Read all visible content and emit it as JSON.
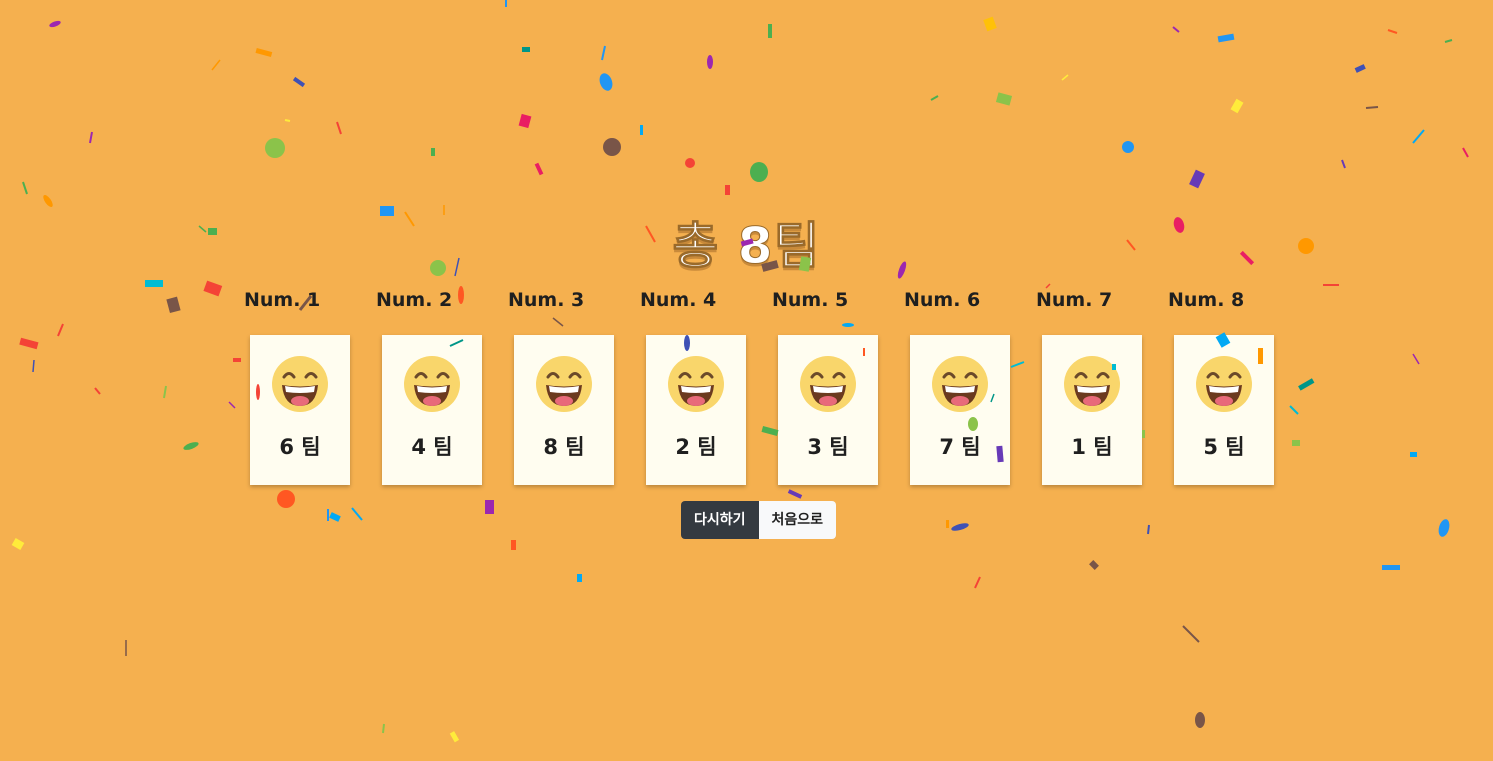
{
  "title": "총 8팀",
  "cards": [
    {
      "label": "Num. 1",
      "team": "6 팀"
    },
    {
      "label": "Num. 2",
      "team": "4 팀"
    },
    {
      "label": "Num. 3",
      "team": "8 팀"
    },
    {
      "label": "Num. 4",
      "team": "2 팀"
    },
    {
      "label": "Num. 5",
      "team": "3 팀"
    },
    {
      "label": "Num. 6",
      "team": "7 팀"
    },
    {
      "label": "Num. 7",
      "team": "1 팀"
    },
    {
      "label": "Num. 8",
      "team": "5 팀"
    }
  ],
  "buttons": {
    "retry": "다시하기",
    "home": "처음으로"
  },
  "card_icon": "grinning-face-icon",
  "colors": {
    "background": "#F5B04F",
    "card": "#FFFDF0",
    "retry_button": "#343a40",
    "home_button": "#f8f9fa"
  }
}
